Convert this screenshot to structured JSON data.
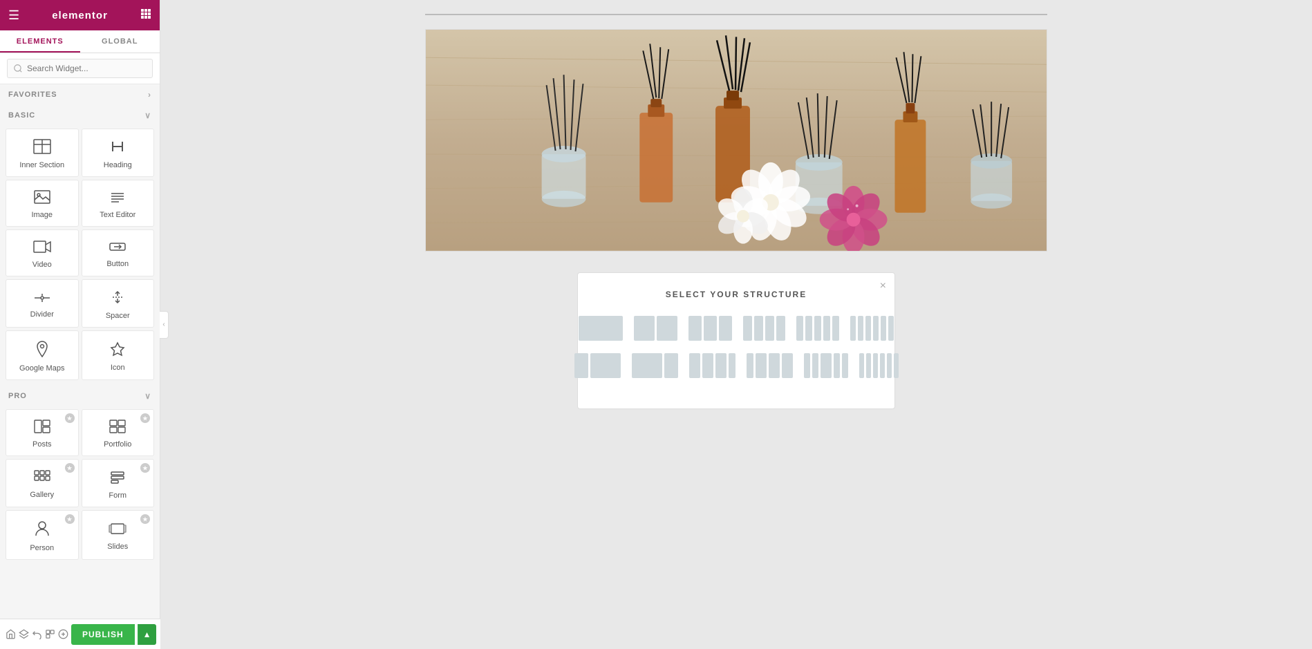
{
  "header": {
    "logo": "elementor",
    "hamburger": "☰",
    "grid": "⠿"
  },
  "tabs": {
    "elements": "ELEMENTS",
    "global": "GLOBAL"
  },
  "search": {
    "placeholder": "Search Widget..."
  },
  "sections": {
    "favorites": {
      "label": "FAVORITES",
      "chevron": "›"
    },
    "basic": {
      "label": "BASIC",
      "chevron": "∨"
    },
    "pro": {
      "label": "PRO",
      "chevron": "∨"
    }
  },
  "widgets": {
    "basic": [
      {
        "id": "inner-section",
        "label": "Inner Section",
        "icon": "inner-section-icon"
      },
      {
        "id": "heading",
        "label": "Heading",
        "icon": "heading-icon"
      },
      {
        "id": "image",
        "label": "Image",
        "icon": "image-icon"
      },
      {
        "id": "text-editor",
        "label": "Text Editor",
        "icon": "text-editor-icon"
      },
      {
        "id": "video",
        "label": "Video",
        "icon": "video-icon"
      },
      {
        "id": "button",
        "label": "Button",
        "icon": "button-icon"
      },
      {
        "id": "divider",
        "label": "Divider",
        "icon": "divider-icon"
      },
      {
        "id": "spacer",
        "label": "Spacer",
        "icon": "spacer-icon"
      },
      {
        "id": "google-maps",
        "label": "Google Maps",
        "icon": "google-maps-icon"
      },
      {
        "id": "icon",
        "label": "Icon",
        "icon": "icon-icon"
      }
    ],
    "pro": [
      {
        "id": "posts",
        "label": "Posts",
        "icon": "posts-icon",
        "pro": true
      },
      {
        "id": "portfolio",
        "label": "Portfolio",
        "icon": "portfolio-icon",
        "pro": true
      },
      {
        "id": "gallery",
        "label": "Gallery",
        "icon": "gallery-icon",
        "pro": true
      },
      {
        "id": "form",
        "label": "Form",
        "icon": "form-icon",
        "pro": true
      },
      {
        "id": "person",
        "label": "Person",
        "icon": "person-icon",
        "pro": true
      },
      {
        "id": "slides",
        "label": "Slides",
        "icon": "slides-icon",
        "pro": true
      }
    ]
  },
  "toolbar": {
    "icons": [
      "⌂",
      "◫",
      "↺",
      "⧉",
      "◎"
    ],
    "publish_label": "PUBLISH",
    "arrow": "▲"
  },
  "structure_selector": {
    "title": "SELECT YOUR STRUCTURE",
    "close": "×"
  },
  "colors": {
    "brand": "#a3145a",
    "publish_green": "#39b54a",
    "publish_green_dark": "#2fa040"
  }
}
